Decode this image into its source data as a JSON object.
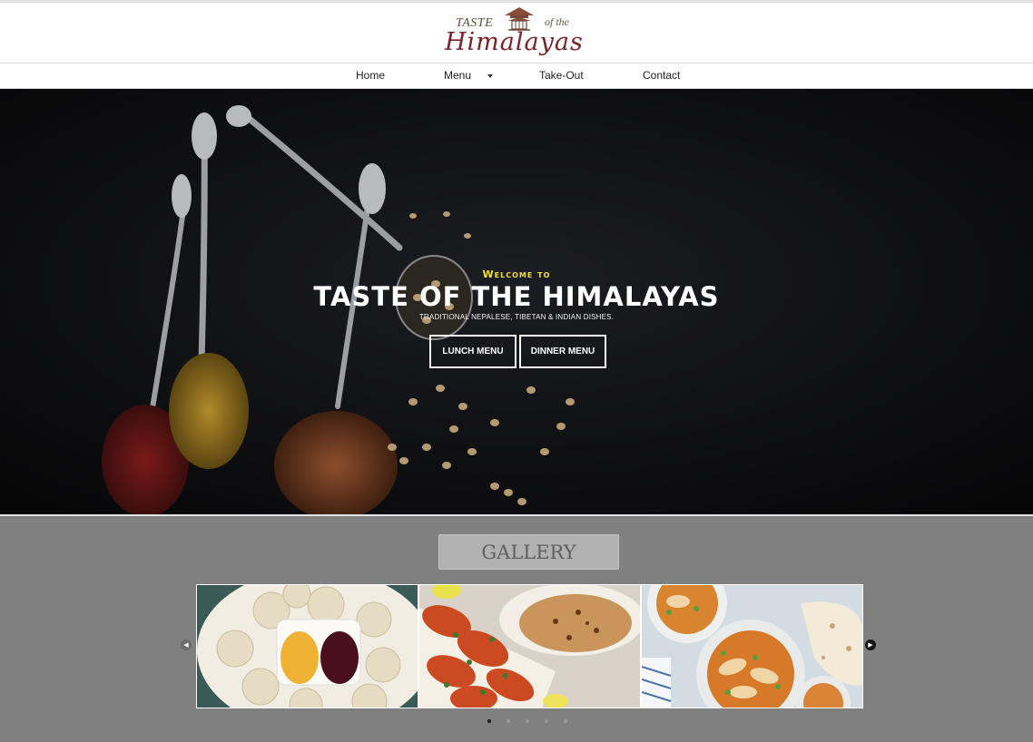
{
  "header": {
    "logo": {
      "line1": "TASTE",
      "line2": "of the",
      "line3": "Himalayas"
    }
  },
  "nav": {
    "items": [
      {
        "label": "Home"
      },
      {
        "label": "Menu"
      },
      {
        "label": "Take-Out"
      },
      {
        "label": "Contact"
      }
    ],
    "dropdown_icon": "caret-down-icon"
  },
  "hero": {
    "welcome": "Welcome to",
    "title": "TASTE OF THE HIMALAYAS",
    "subtitle": "TRADITIONAL NEPALESE, TIBETAN & INDIAN DISHES.",
    "buttons": [
      {
        "label": "LUNCH MENU"
      },
      {
        "label": "DINNER MENU"
      }
    ]
  },
  "gallery": {
    "title": "GALLERY",
    "slides": [
      {
        "subject": "momo-dumplings-with-dipping-sauces"
      },
      {
        "subject": "tandoori-chicken-and-naan"
      },
      {
        "subject": "curry-bowls-with-naan"
      }
    ],
    "prev_icon": "chevron-left-icon",
    "next_icon": "chevron-right-icon",
    "dots": 5,
    "active_dot": 1
  },
  "colors": {
    "welcome_yellow": "#f2e12c",
    "gallery_background": "#808080",
    "logo_red": "#7a2228"
  }
}
